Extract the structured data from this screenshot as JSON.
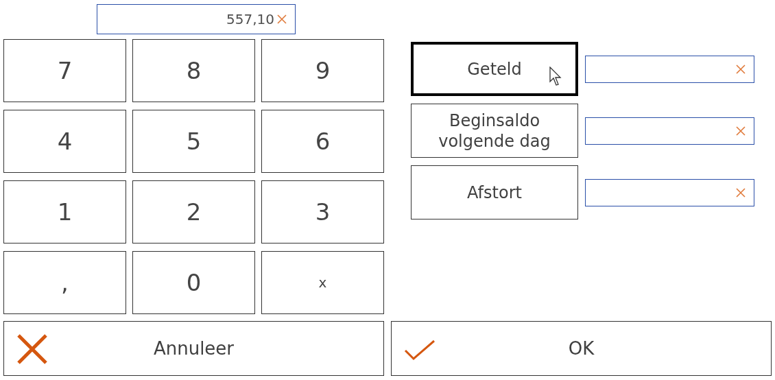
{
  "display": {
    "value": "557,10"
  },
  "keypad": [
    {
      "label": "7",
      "kind": "digit"
    },
    {
      "label": "8",
      "kind": "digit"
    },
    {
      "label": "9",
      "kind": "digit"
    },
    {
      "label": "4",
      "kind": "digit"
    },
    {
      "label": "5",
      "kind": "digit"
    },
    {
      "label": "6",
      "kind": "digit"
    },
    {
      "label": "1",
      "kind": "digit"
    },
    {
      "label": "2",
      "kind": "digit"
    },
    {
      "label": "3",
      "kind": "digit"
    },
    {
      "label": ",",
      "kind": "digit"
    },
    {
      "label": "0",
      "kind": "digit"
    },
    {
      "label": "x",
      "kind": "clear"
    }
  ],
  "amounts": [
    {
      "label": "Geteld",
      "selected": true
    },
    {
      "label": "Beginsaldo volgende dag",
      "selected": false
    },
    {
      "label": "Afstort",
      "selected": false
    }
  ],
  "actions": [
    {
      "label": "Annuleer",
      "kind": "cancel"
    },
    {
      "label": "OK",
      "kind": "confirm"
    }
  ]
}
